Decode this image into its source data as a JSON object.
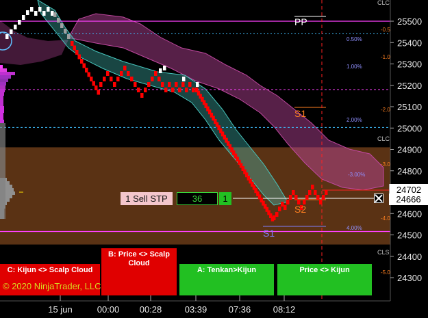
{
  "chart_data": {
    "type": "renko",
    "y_axis": {
      "ticks": [
        25500,
        25400,
        25300,
        25200,
        25100,
        25000,
        24900,
        24800,
        24700,
        24600,
        24500,
        24400,
        24300
      ],
      "labels": [
        "25500",
        "25400",
        "25300",
        "25200",
        "25100",
        "25000",
        "24900",
        "24800",
        "24700",
        "24600",
        "24500",
        "24400",
        "24300"
      ],
      "range": [
        24195,
        25600
      ]
    },
    "x_axis": {
      "labels": [
        "15 jun",
        "00:00",
        "00:28",
        "03:39",
        "07:36",
        "08:12"
      ]
    },
    "price_tags": {
      "last": "24702",
      "ask": "24666"
    },
    "pivot_labels": [
      "PP",
      "S1",
      "S2",
      "S1"
    ],
    "vwap_band_labels": [
      "0.50%",
      "1.00%",
      "2.00%",
      "-3.00%",
      "4.00%"
    ],
    "percent_labels": [
      "-0.5",
      "-1.0",
      "-2.0",
      "-3.0",
      "-4.0",
      "-5.0"
    ],
    "side_labels": [
      "CLC",
      "CLC",
      "CLS"
    ],
    "colors": {
      "background": "#000000",
      "brick_down": "#ff0000",
      "brick_up": "#ffffff",
      "brick_neutral": "#a0a0a0",
      "cloud_bear": "#c048a0",
      "cloud_bull": "#48c8c0",
      "zone": "#5a3214",
      "magenta_line": "#ff40ff",
      "cyan_line": "#40c0ff",
      "pivot_orange": "#ff8020"
    }
  },
  "order": {
    "label": "1  Sell STP",
    "qty": "36",
    "count": "1"
  },
  "signals": [
    {
      "label": "C: Kijun <> Scalp Cloud",
      "color": "#e00000"
    },
    {
      "label": "B: Price <> Scalp Cloud",
      "color": "#e00000"
    },
    {
      "label": "A: Tenkan>Kijun",
      "color": "#22c022"
    },
    {
      "label": "Price <> Kijun",
      "color": "#22c022"
    }
  ],
  "footer": {
    "copyright": "© 2020 NinjaTrader, LLC"
  }
}
